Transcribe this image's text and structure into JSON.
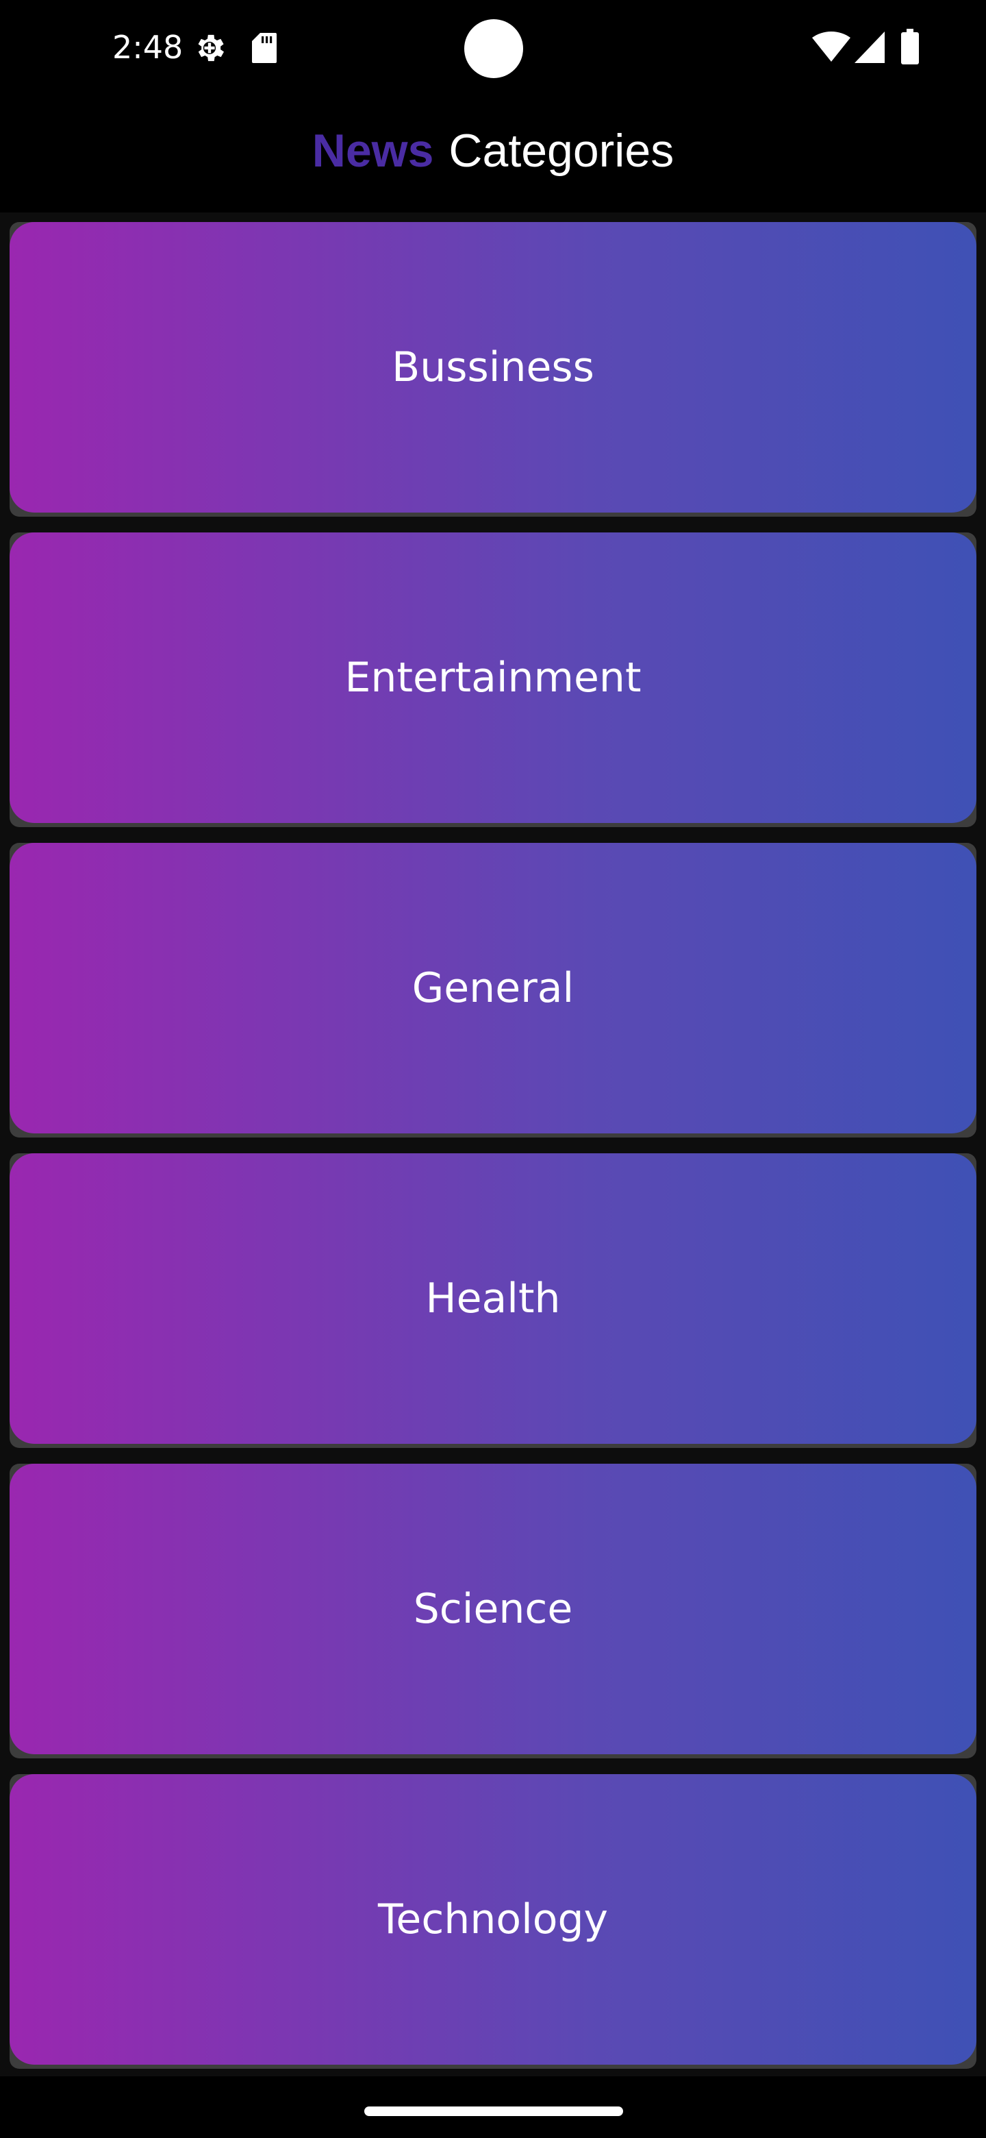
{
  "status_bar": {
    "time": "2:48",
    "icons": [
      "gear-icon",
      "sd-card-icon",
      "wifi-icon",
      "cellular-signal-icon",
      "battery-icon"
    ]
  },
  "app_bar": {
    "title_accent": "News",
    "title_main": "Categories",
    "accent_color": "#4a2ca3"
  },
  "categories": [
    {
      "label": "Bussiness"
    },
    {
      "label": "Entertainment"
    },
    {
      "label": "General"
    },
    {
      "label": "Health"
    },
    {
      "label": "Science"
    },
    {
      "label": "Technology"
    }
  ],
  "colors": {
    "gradient_start": "#9a27b0",
    "gradient_end": "#3f51b5",
    "background": "#000000"
  }
}
